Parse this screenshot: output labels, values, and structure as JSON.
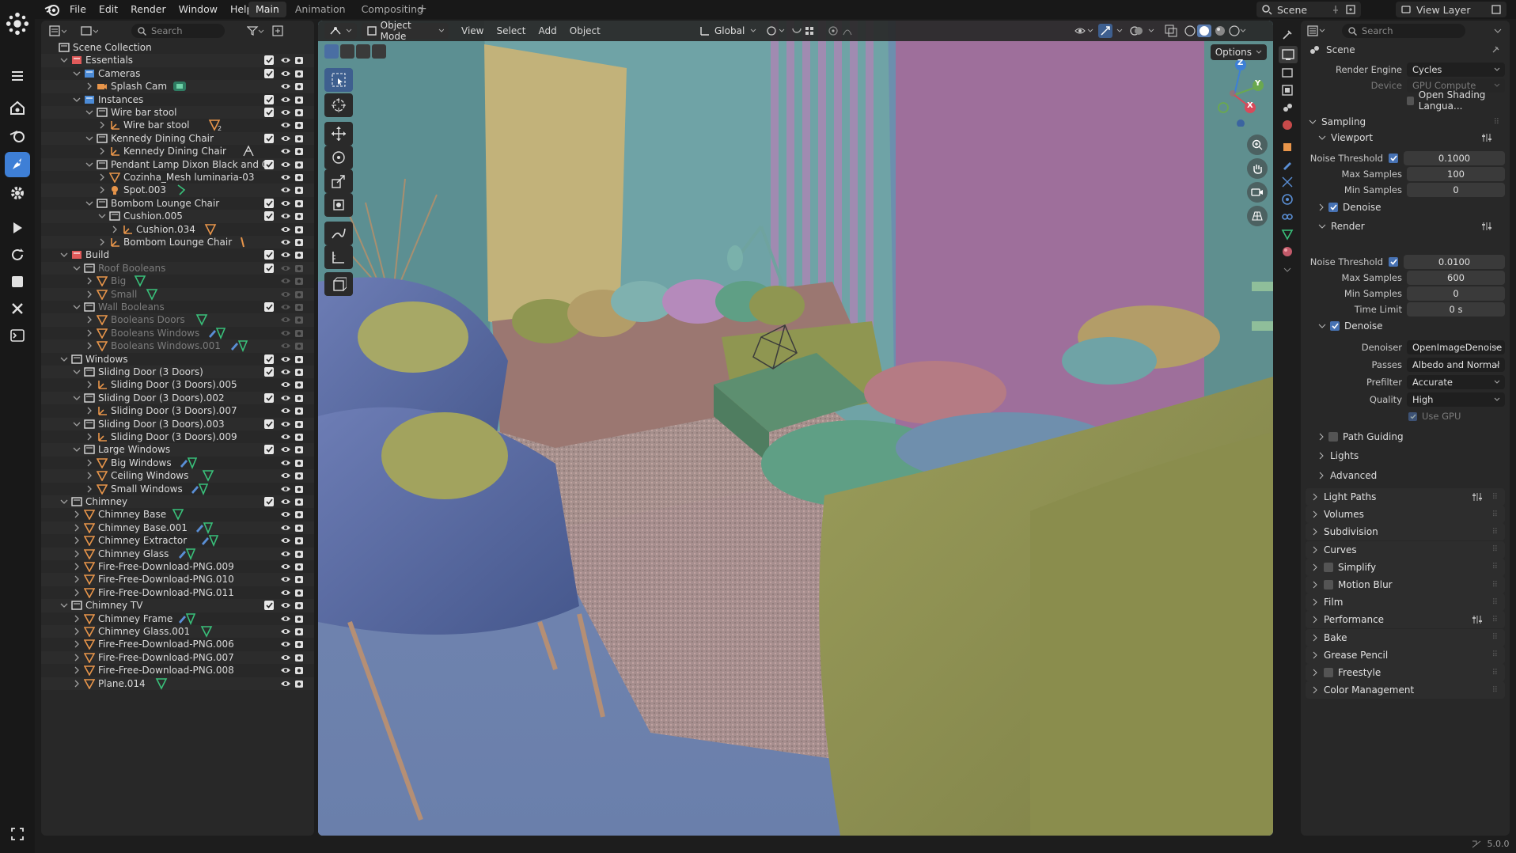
{
  "topbar": {
    "menus": [
      "File",
      "Edit",
      "Render",
      "Window",
      "Help"
    ],
    "workspaces": [
      "Main",
      "Animation",
      "Compositing"
    ],
    "add_workspace": "+",
    "scene": "Scene",
    "view_layer": "View Layer"
  },
  "outliner": {
    "search_placeholder": "Search",
    "rows": [
      {
        "label": "Scene Collection",
        "depth": 0,
        "icon": "scene-collection",
        "tw": ""
      },
      {
        "label": "Essentials",
        "depth": 1,
        "icon": "collection-red",
        "tw": "open",
        "chk": true
      },
      {
        "label": "Cameras",
        "depth": 2,
        "icon": "collection-blue",
        "tw": "open",
        "chk": true
      },
      {
        "label": "Splash Cam",
        "depth": 3,
        "icon": "camera",
        "tw": "closed",
        "extra": "camera-data"
      },
      {
        "label": "Instances",
        "depth": 2,
        "icon": "collection-blue",
        "tw": "open",
        "chk": true
      },
      {
        "label": "Wire bar stool",
        "depth": 3,
        "icon": "collection",
        "tw": "open",
        "chk": true
      },
      {
        "label": "Wire bar stool",
        "depth": 4,
        "icon": "empty",
        "tw": "closed",
        "extra": "mesh-2"
      },
      {
        "label": "Kennedy Dining Chair",
        "depth": 3,
        "icon": "collection",
        "tw": "open",
        "chk": true
      },
      {
        "label": "Kennedy Dining Chair",
        "depth": 4,
        "icon": "empty",
        "tw": "closed",
        "extra": "particles"
      },
      {
        "label": "Pendant Lamp Dixon Black and C",
        "depth": 3,
        "icon": "collection",
        "tw": "open",
        "chk": true
      },
      {
        "label": "Cozinha_Mesh luminaria-03",
        "depth": 4,
        "icon": "mesh",
        "tw": "closed"
      },
      {
        "label": "Spot.003",
        "depth": 4,
        "icon": "light",
        "tw": "closed",
        "extra": "light-data"
      },
      {
        "label": "Bombom Lounge Chair",
        "depth": 3,
        "icon": "collection",
        "tw": "open",
        "chk": true
      },
      {
        "label": "Cushion.005",
        "depth": 4,
        "icon": "collection",
        "tw": "open",
        "chk": true
      },
      {
        "label": "Cushion.034",
        "depth": 5,
        "icon": "empty",
        "tw": "closed",
        "extra": "mesh"
      },
      {
        "label": "Bombom Lounge Chair",
        "depth": 4,
        "icon": "empty",
        "tw": "closed",
        "extra": "mesh-small"
      },
      {
        "label": "Build",
        "depth": 1,
        "icon": "collection-red",
        "tw": "open",
        "chk": true
      },
      {
        "label": "Roof Booleans",
        "depth": 2,
        "icon": "collection",
        "tw": "open",
        "chk": true,
        "dim": true
      },
      {
        "label": "Big",
        "depth": 3,
        "icon": "mesh",
        "tw": "closed",
        "dim": true,
        "extra": "mesh-data"
      },
      {
        "label": "Small",
        "depth": 3,
        "icon": "mesh",
        "tw": "closed",
        "dim": true,
        "extra": "mesh-data"
      },
      {
        "label": "Wall Booleans",
        "depth": 2,
        "icon": "collection",
        "tw": "open",
        "chk": true,
        "dim": true
      },
      {
        "label": "Booleans Doors",
        "depth": 3,
        "icon": "mesh",
        "tw": "closed",
        "dim": true,
        "extra": "mesh-data"
      },
      {
        "label": "Booleans Windows",
        "depth": 3,
        "icon": "mesh",
        "tw": "closed",
        "dim": true,
        "extra": "mod-mesh"
      },
      {
        "label": "Booleans Windows.001",
        "depth": 3,
        "icon": "mesh",
        "tw": "closed",
        "dim": true,
        "extra": "mod-mesh"
      },
      {
        "label": "Windows",
        "depth": 1,
        "icon": "collection",
        "tw": "open",
        "chk": true
      },
      {
        "label": "Sliding Door (3 Doors)",
        "depth": 2,
        "icon": "collection",
        "tw": "open",
        "chk": true
      },
      {
        "label": "Sliding Door (3 Doors).005",
        "depth": 3,
        "icon": "empty",
        "tw": "closed"
      },
      {
        "label": "Sliding Door (3 Doors).002",
        "depth": 2,
        "icon": "collection",
        "tw": "open",
        "chk": true
      },
      {
        "label": "Sliding Door (3 Doors).007",
        "depth": 3,
        "icon": "empty",
        "tw": "closed"
      },
      {
        "label": "Sliding Door (3 Doors).003",
        "depth": 2,
        "icon": "collection",
        "tw": "open",
        "chk": true
      },
      {
        "label": "Sliding Door (3 Doors).009",
        "depth": 3,
        "icon": "empty",
        "tw": "closed"
      },
      {
        "label": "Large Windows",
        "depth": 2,
        "icon": "collection",
        "tw": "open",
        "chk": true
      },
      {
        "label": "Big Windows",
        "depth": 3,
        "icon": "mesh",
        "tw": "closed",
        "extra": "mod-mesh"
      },
      {
        "label": "Ceiling Windows",
        "depth": 3,
        "icon": "mesh",
        "tw": "closed",
        "extra": "mesh-data"
      },
      {
        "label": "Small Windows",
        "depth": 3,
        "icon": "mesh",
        "tw": "closed",
        "extra": "mod-mesh"
      },
      {
        "label": "Chimney",
        "depth": 1,
        "icon": "collection",
        "tw": "open",
        "chk": true
      },
      {
        "label": "Chimney Base",
        "depth": 2,
        "icon": "mesh",
        "tw": "closed",
        "extra": "mesh-data"
      },
      {
        "label": "Chimney Base.001",
        "depth": 2,
        "icon": "mesh",
        "tw": "closed",
        "extra": "mod-mesh"
      },
      {
        "label": "Chimney Extractor",
        "depth": 2,
        "icon": "mesh",
        "tw": "closed",
        "extra": "mod-mesh"
      },
      {
        "label": "Chimney Glass",
        "depth": 2,
        "icon": "mesh",
        "tw": "closed",
        "extra": "mod-mesh"
      },
      {
        "label": "Fire-Free-Download-PNG.009",
        "depth": 2,
        "icon": "mesh",
        "tw": "closed"
      },
      {
        "label": "Fire-Free-Download-PNG.010",
        "depth": 2,
        "icon": "mesh",
        "tw": "closed"
      },
      {
        "label": "Fire-Free-Download-PNG.011",
        "depth": 2,
        "icon": "mesh",
        "tw": "closed"
      },
      {
        "label": "Chimney TV",
        "depth": 1,
        "icon": "collection",
        "tw": "open",
        "chk": true
      },
      {
        "label": "Chimney Frame",
        "depth": 2,
        "icon": "mesh",
        "tw": "closed",
        "extra": "mod-mesh"
      },
      {
        "label": "Chimney Glass.001",
        "depth": 2,
        "icon": "mesh",
        "tw": "closed",
        "extra": "mesh-data"
      },
      {
        "label": "Fire-Free-Download-PNG.006",
        "depth": 2,
        "icon": "mesh",
        "tw": "closed"
      },
      {
        "label": "Fire-Free-Download-PNG.007",
        "depth": 2,
        "icon": "mesh",
        "tw": "closed"
      },
      {
        "label": "Fire-Free-Download-PNG.008",
        "depth": 2,
        "icon": "mesh",
        "tw": "closed"
      },
      {
        "label": "Plane.014",
        "depth": 2,
        "icon": "mesh",
        "tw": "closed",
        "extra": "mesh-data"
      }
    ]
  },
  "viewport": {
    "mode": "Object Mode",
    "menus": [
      "View",
      "Select",
      "Add",
      "Object"
    ],
    "orientation": "Global",
    "options": "Options",
    "gizmo": {
      "z": "Z",
      "y": "Y",
      "x": "X"
    }
  },
  "properties": {
    "search_placeholder": "Search",
    "context": "Scene",
    "render_engine_label": "Render Engine",
    "render_engine": "Cycles",
    "device_label": "Device",
    "device": "GPU Compute",
    "osl_label": "Open Shading Langua...",
    "sampling": "Sampling",
    "viewport": "Viewport",
    "v_noise_label": "Noise Threshold",
    "v_noise": "0.1000",
    "v_max_label": "Max Samples",
    "v_max": "100",
    "v_min_label": "Min Samples",
    "v_min": "0",
    "v_denoise": "Denoise",
    "render": "Render",
    "r_noise_label": "Noise Threshold",
    "r_noise": "0.0100",
    "r_max_label": "Max Samples",
    "r_max": "600",
    "r_min_label": "Min Samples",
    "r_min": "0",
    "r_time_label": "Time Limit",
    "r_time": "0 s",
    "r_denoise": "Denoise",
    "denoiser_label": "Denoiser",
    "denoiser": "OpenImageDenoise",
    "passes_label": "Passes",
    "passes": "Albedo and Normal",
    "prefilter_label": "Prefilter",
    "prefilter": "Accurate",
    "quality_label": "Quality",
    "quality": "High",
    "use_gpu": "Use GPU",
    "path_guiding": "Path Guiding",
    "lights": "Lights",
    "advanced": "Advanced",
    "sections": [
      {
        "label": "Light Paths",
        "preset": true
      },
      {
        "label": "Volumes"
      },
      {
        "label": "Subdivision"
      },
      {
        "label": "Curves"
      },
      {
        "label": "Simplify",
        "check": true
      },
      {
        "label": "Motion Blur",
        "check": true
      },
      {
        "label": "Film"
      },
      {
        "label": "Performance",
        "preset": true
      },
      {
        "label": "Bake"
      },
      {
        "label": "Grease Pencil"
      },
      {
        "label": "Freestyle",
        "check": true
      },
      {
        "label": "Color Management"
      }
    ]
  },
  "status": {
    "version": "5.0.0"
  },
  "colors": {
    "accent": "#4772b3",
    "active_tool": "#3e7fd6",
    "collection_red": "#e05a5a",
    "object_orange": "#e8954a",
    "mesh_data_green": "#39c07a"
  }
}
